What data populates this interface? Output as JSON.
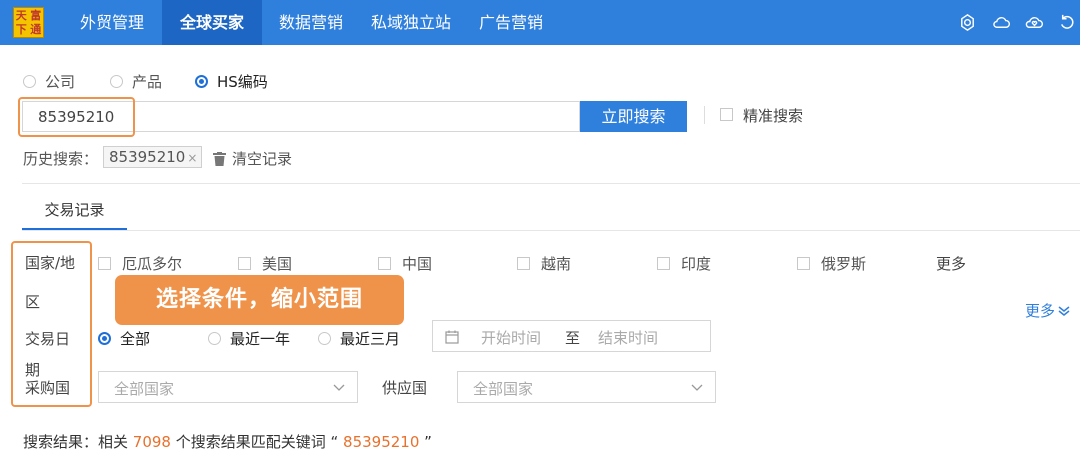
{
  "logo": {
    "chars": [
      "天",
      "富",
      "下",
      "通"
    ]
  },
  "nav": {
    "items": [
      {
        "label": "外贸管理"
      },
      {
        "label": "全球买家"
      },
      {
        "label": "数据营销"
      },
      {
        "label": "私域独立站"
      },
      {
        "label": "广告营销"
      }
    ],
    "icons": [
      "openai-icon",
      "cloud-icon",
      "cloud-heart-icon",
      "refresh-icon"
    ]
  },
  "search_type": {
    "options": [
      {
        "label": "公司",
        "selected": false
      },
      {
        "label": "产品",
        "selected": false
      },
      {
        "label": "HS编码",
        "selected": true
      }
    ]
  },
  "search": {
    "value": "85395210",
    "button_label": "立即搜索",
    "exact_label": "精准搜索"
  },
  "history": {
    "label": "历史搜索：",
    "tags": [
      {
        "text": "85395210",
        "close": "×"
      }
    ],
    "clear_label": "清空记录"
  },
  "tabs": [
    {
      "label": "交易记录"
    }
  ],
  "filters": {
    "region_label_1": "国家/地",
    "region_label_2": "区",
    "date_label_1": "交易日",
    "date_label_2": "期",
    "buyer_label": "采购国",
    "countries": [
      "厄瓜多尔",
      "美国",
      "中国",
      "越南",
      "印度",
      "俄罗斯"
    ],
    "country_more": "更多",
    "date_options": [
      {
        "label": "全部",
        "selected": true
      },
      {
        "label": "最近一年",
        "selected": false
      },
      {
        "label": "最近三月",
        "selected": false
      }
    ],
    "date_start_placeholder": "开始时间",
    "date_sep": "至",
    "date_end_placeholder": "结束时间",
    "buyer_placeholder": "全部国家",
    "supplier_label": "供应国",
    "supplier_placeholder": "全部国家",
    "more_label": "更多"
  },
  "callout": {
    "text": "选择条件，缩小范围"
  },
  "result": {
    "prefix": "搜索结果：相关 ",
    "count": "7098",
    "middle": " 个搜索结果匹配关键词 “ ",
    "keyword": "85395210",
    "suffix": " ”"
  },
  "colors": {
    "primary": "#2f7fdc",
    "nav_active": "#1d66c3",
    "highlight": "#f0934a",
    "accent_text": "#e8712c"
  }
}
